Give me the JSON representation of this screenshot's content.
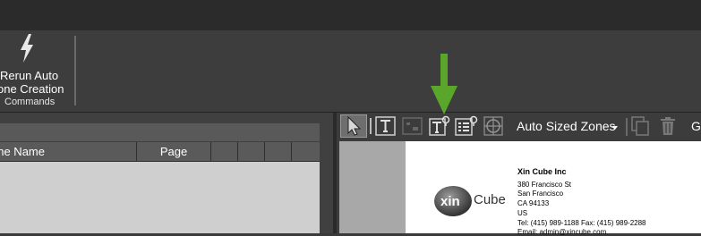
{
  "ribbon": {
    "rerun_line1": "Rerun Auto",
    "rerun_line2": "one Creation",
    "group_label": "Commands"
  },
  "grid": {
    "columns": [
      "one Name",
      "Page",
      "",
      "",
      "",
      ""
    ]
  },
  "toolbar": {
    "zone_mode": "Auto Sized Zones",
    "more_label": "G"
  },
  "document": {
    "company": "Xin Cube Inc",
    "address_line1": "380 Francisco St",
    "address_line2": "San Francisco",
    "address_line3": "CA 94133",
    "address_line4": "US",
    "phones": "Tel:  (415) 989-1188    Fax: (415) 989-2288",
    "email": "Email:    admin@xincube.com",
    "logo_text_left": "xin",
    "logo_text_right": "Cube"
  },
  "colors": {
    "highlight_arrow": "#5aa62a",
    "background": "#3a3a3a",
    "grid_body": "#cfcfcf"
  }
}
